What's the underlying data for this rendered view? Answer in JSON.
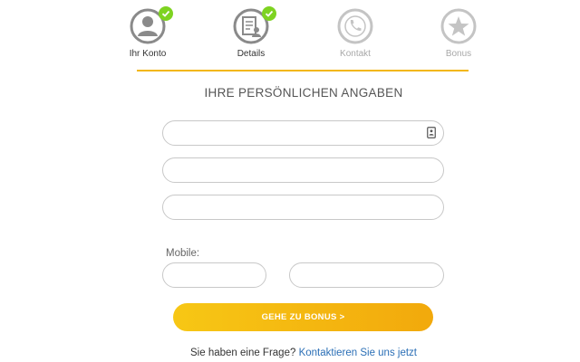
{
  "stepper": {
    "steps": [
      {
        "label": "Ihr Konto",
        "icon": "user-icon",
        "state": "done"
      },
      {
        "label": "Details",
        "icon": "document-user-icon",
        "state": "done"
      },
      {
        "label": "Kontakt",
        "icon": "phone-icon",
        "state": "pending"
      },
      {
        "label": "Bonus",
        "icon": "star-icon",
        "state": "pending"
      }
    ],
    "done_color": "#7ed321",
    "accent_color": "#f3b712"
  },
  "form": {
    "title": "IHRE PERSÖNLICHEN ANGABEN",
    "fields": [
      {
        "value": "",
        "placeholder": "",
        "icon": "contact-card-icon"
      },
      {
        "value": "",
        "placeholder": ""
      },
      {
        "value": "",
        "placeholder": ""
      }
    ],
    "mobile": {
      "label": "Mobile:",
      "prefix_value": "",
      "number_value": ""
    },
    "submit_label": "GEHE ZU BONUS >"
  },
  "help": {
    "question": "Sie haben eine Frage?",
    "link_text": "Kontaktieren Sie uns jetzt"
  }
}
